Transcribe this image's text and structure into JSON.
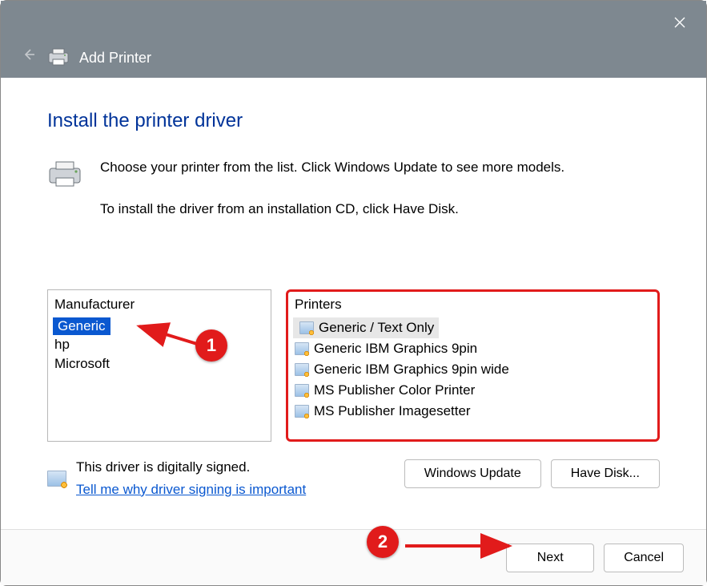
{
  "header": {
    "title": "Add Printer",
    "close": "Close"
  },
  "page": {
    "heading": "Install the printer driver",
    "line1": "Choose your printer from the list. Click Windows Update to see more models.",
    "line2": "To install the driver from an installation CD, click Have Disk."
  },
  "mfr": {
    "header": "Manufacturer",
    "items": [
      "Generic",
      "hp",
      "Microsoft"
    ],
    "selected_index": 0
  },
  "printers": {
    "header": "Printers",
    "items": [
      "Generic / Text Only",
      "Generic IBM Graphics 9pin",
      "Generic IBM Graphics 9pin wide",
      "MS Publisher Color Printer",
      "MS Publisher Imagesetter"
    ],
    "selected_index": 0
  },
  "signing": {
    "status": "This driver is digitally signed.",
    "link": "Tell me why driver signing is important"
  },
  "buttons": {
    "windows_update": "Windows Update",
    "have_disk": "Have Disk...",
    "next": "Next",
    "cancel": "Cancel"
  },
  "annotations": {
    "n1": "1",
    "n2": "2"
  }
}
